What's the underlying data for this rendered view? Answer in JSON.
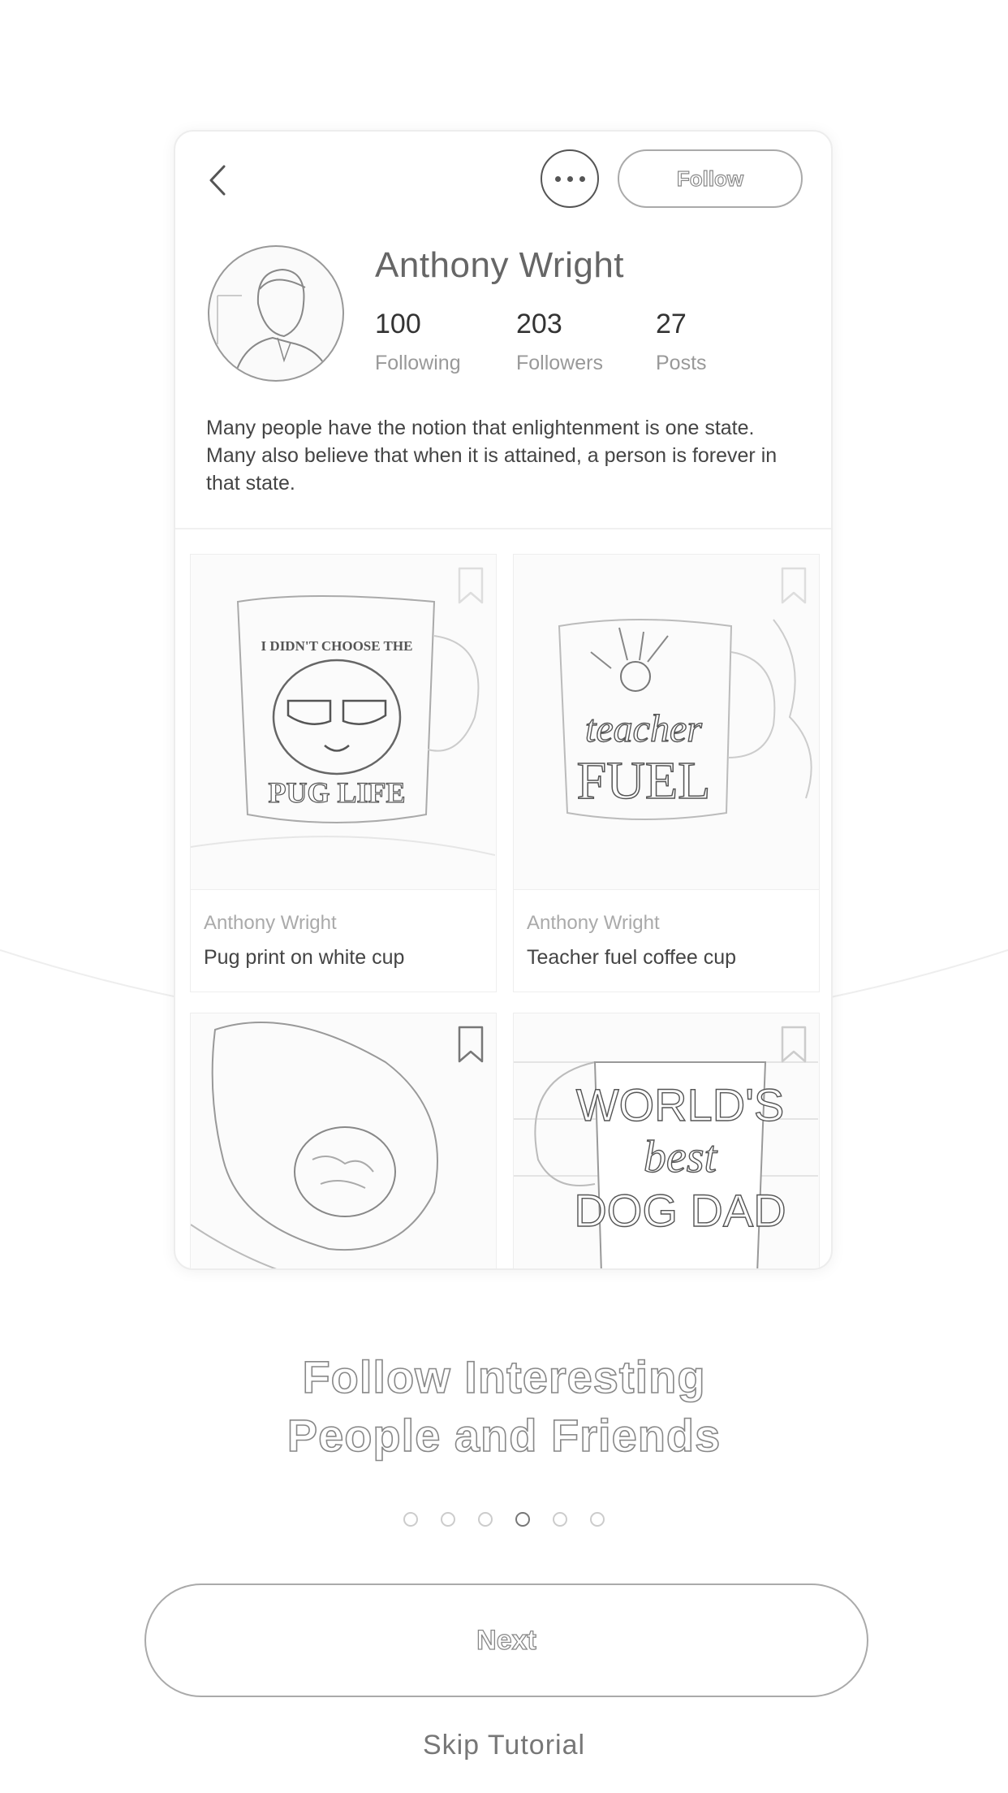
{
  "profile": {
    "name": "Anthony Wright",
    "stats": [
      {
        "value": "100",
        "label": "Following"
      },
      {
        "value": "203",
        "label": "Followers"
      },
      {
        "value": "27",
        "label": "Posts"
      }
    ],
    "bio": "Many people have the notion that enlightenment is one state. Many also believe that when it is attained, a person is forever in that state.",
    "follow_label": "Follow"
  },
  "posts": [
    {
      "author": "Anthony Wright",
      "title": "Pug print on white cup",
      "image_text_top": "I DIDN'T CHOOSE THE",
      "image_text_bottom": "PUG LIFE"
    },
    {
      "author": "Anthony Wright",
      "title": "Teacher fuel coffee cup",
      "image_text_top": "teacher",
      "image_text_bottom": "FUEL"
    },
    {
      "author": "",
      "title": ""
    },
    {
      "author": "",
      "title": "",
      "image_text_top": "WORLD'S",
      "image_text_mid": "best",
      "image_text_bottom": "DOG DAD"
    }
  ],
  "onboarding": {
    "headline_line1": "Follow Interesting",
    "headline_line2": "People and Friends",
    "page_count": 6,
    "active_page": 4,
    "next_label": "Next",
    "skip_label": "Skip Tutorial"
  }
}
